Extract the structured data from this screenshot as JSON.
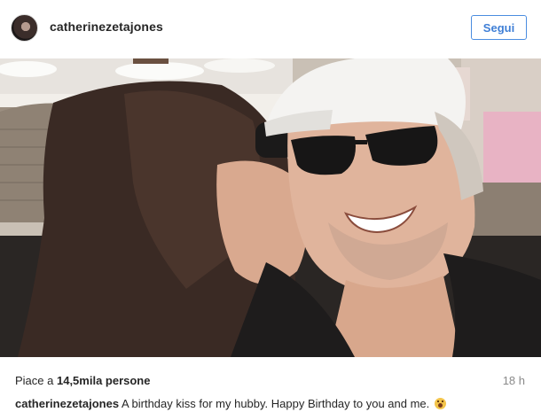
{
  "header": {
    "username": "catherinezetajones",
    "follow_label": "Segui"
  },
  "likes": {
    "prefix": "Piace a ",
    "count": "14,5mila persone"
  },
  "time": "18 h",
  "caption": {
    "user": "catherinezetajones",
    "text": " A birthday kiss for my hubby. Happy Birthday to you and me. "
  },
  "icons": {
    "emoji": "astonished-face-icon",
    "avatar": "profile-avatar"
  },
  "colors": {
    "follow_border": "#4b8de0",
    "follow_text": "#3f7fd6",
    "muted_text": "#8a8a8a"
  }
}
